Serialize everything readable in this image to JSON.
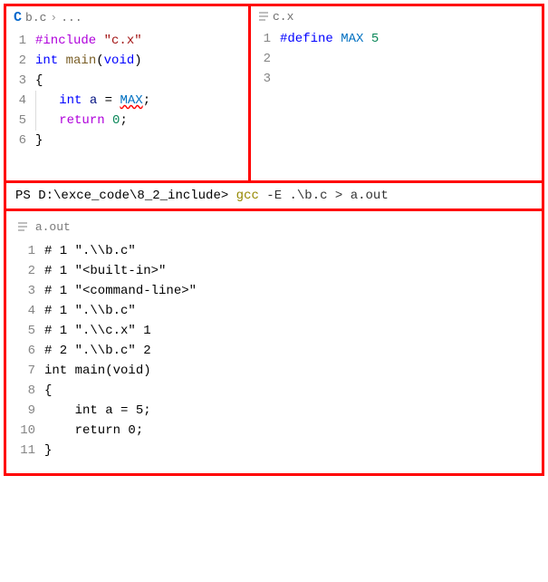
{
  "left": {
    "file_icon": "C",
    "file_name": "b.c",
    "breadcrumb_sep": "›",
    "breadcrumb_more": "...",
    "lines": {
      "l1": {
        "n": "1"
      },
      "l2": {
        "n": "2"
      },
      "l3": {
        "n": "3"
      },
      "l4": {
        "n": "4"
      },
      "l5": {
        "n": "5"
      },
      "l6": {
        "n": "6"
      }
    },
    "code": {
      "include_kw": "#include",
      "include_sp": " ",
      "include_str": "\"c.x\"",
      "int": "int",
      "sp": " ",
      "main": "main",
      "void_paren": "(",
      "void": "void",
      "close_paren": ")",
      "open_brace": "{",
      "indent4": "    ",
      "a": "a",
      "eq": " = ",
      "max": "MAX",
      "semi": ";",
      "return": "return",
      "zero": "0",
      "close_brace": "}"
    }
  },
  "right": {
    "file_name": "c.x",
    "lines": {
      "l1": {
        "n": "1"
      },
      "l2": {
        "n": "2"
      },
      "l3": {
        "n": "3"
      }
    },
    "code": {
      "define": "#define",
      "sp": " ",
      "max": "MAX",
      "val": "5"
    }
  },
  "terminal": {
    "prompt": "PS ",
    "path": "D:\\exce_code\\8_2_include",
    "gt": "> ",
    "cmd": "gcc",
    "args": " -E .\\b.c > a.out"
  },
  "bottom": {
    "file_name": "a.out",
    "lines": {
      "l1": {
        "n": "1",
        "t": "# 1 \".\\\\b.c\""
      },
      "l2": {
        "n": "2",
        "t": "# 1 \"<built-in>\""
      },
      "l3": {
        "n": "3",
        "t": "# 1 \"<command-line>\""
      },
      "l4": {
        "n": "4",
        "t": "# 1 \".\\\\b.c\""
      },
      "l5": {
        "n": "5",
        "t": "# 1 \".\\\\c.x\" 1"
      },
      "l6": {
        "n": "6",
        "t": "# 2 \".\\\\b.c\" 2"
      },
      "l7": {
        "n": "7",
        "t": "int main(void)"
      },
      "l8": {
        "n": "8",
        "t": "{"
      },
      "l9": {
        "n": "9",
        "t": "    int a = 5;"
      },
      "l10": {
        "n": "10",
        "t": "    return 0;"
      },
      "l11": {
        "n": "11",
        "t": "}"
      }
    }
  }
}
